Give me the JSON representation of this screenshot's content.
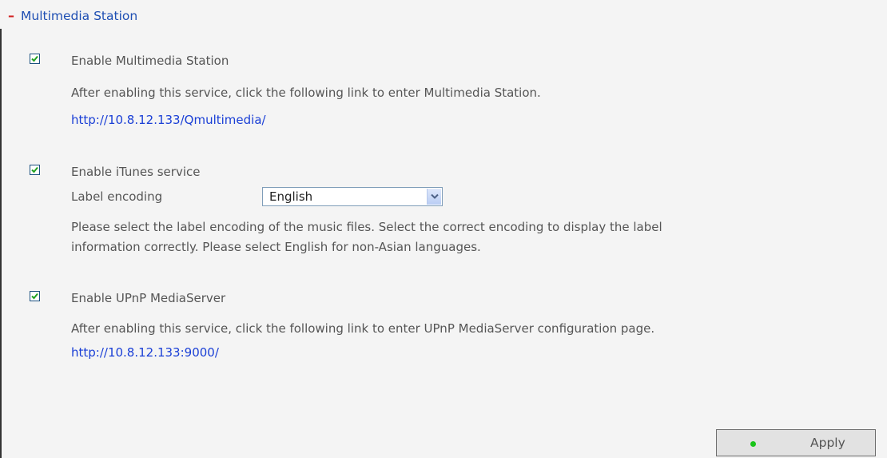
{
  "section": {
    "collapse_symbol": "–",
    "title": "Multimedia Station"
  },
  "multimedia": {
    "enable_label": "Enable Multimedia Station",
    "checked": true,
    "description": "After enabling this service, click the following link to enter Multimedia Station.",
    "link": "http://10.8.12.133/Qmultimedia/"
  },
  "itunes": {
    "enable_label": "Enable iTunes service",
    "checked": true,
    "encoding_label": "Label encoding",
    "encoding_value": "English",
    "description_line1": "Please select the label encoding of the music files. Select the correct encoding to display the label",
    "description_line2": "information correctly. Please select English for non-Asian languages."
  },
  "upnp": {
    "enable_label": "Enable UPnP MediaServer",
    "checked": true,
    "description": "After enabling this service, click the following link to enter UPnP MediaServer configuration page.",
    "link": "http://10.8.12.133:9000/"
  },
  "footer": {
    "apply_label": "Apply"
  },
  "colors": {
    "header_text": "#1f4fb3",
    "collapse_icon": "#d11f1f",
    "link": "#1a3fd6",
    "status_dot": "#19c419"
  },
  "icons": {
    "collapse": "minus-icon",
    "checkbox": "check-icon",
    "dropdown": "chevron-down-icon",
    "apply": "green-dot-icon"
  }
}
